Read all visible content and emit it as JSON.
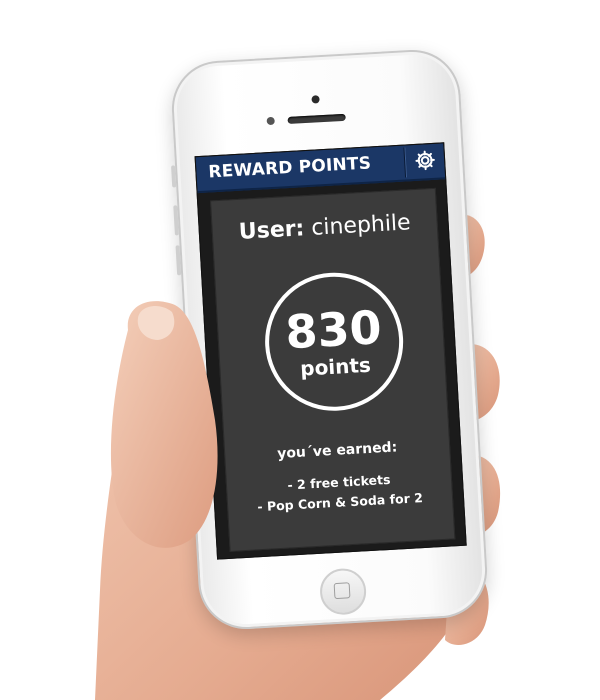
{
  "app": {
    "title": "REWARD POINTS"
  },
  "user": {
    "label": "User:",
    "name": "cinephile"
  },
  "points": {
    "value": "830",
    "unit": "points"
  },
  "rewards": {
    "title": "you´ve earned:",
    "items": [
      "- 2 free tickets",
      "- Pop Corn & Soda for 2"
    ]
  },
  "colors": {
    "header": "#1b3766",
    "card": "#3b3b3b",
    "screen": "#1b1b1b",
    "text": "#ffffff"
  },
  "icons": {
    "settings": "gear-icon"
  }
}
